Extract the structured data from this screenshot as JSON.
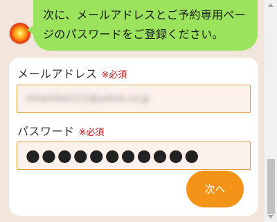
{
  "chat": {
    "message_line1": "次に、メールアドレスとご予約専用ペー",
    "message_line2": "ジのパスワードをご登録ください。",
    "bubble_color": "#9be35c"
  },
  "form": {
    "email": {
      "label": "メールアドレス",
      "required_mark": "※必須",
      "value": "mitamita1111@yahoo.co.jp"
    },
    "password": {
      "label": "パスワード",
      "required_mark": "※必須",
      "value": "●●●●●●●●●●●"
    },
    "next_label": "次へ"
  },
  "colors": {
    "background": "#f2e6dc",
    "accent": "#f39418",
    "required": "#c81414",
    "field_border": "#e09a3a"
  }
}
